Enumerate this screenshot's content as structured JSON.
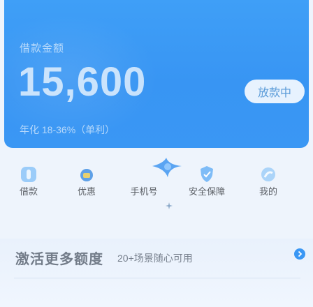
{
  "hero": {
    "label": "借款金额",
    "amount": "15,600",
    "rate": "年化 18-36%（单利）",
    "button_label": "放款中"
  },
  "services": {
    "items": [
      {
        "label": "借款",
        "icon": "borrow-icon"
      },
      {
        "label": "优惠",
        "icon": "coupon-icon"
      },
      {
        "label": "手机号",
        "icon": "phone-icon"
      },
      {
        "label": "安全保障",
        "icon": "shield-icon"
      },
      {
        "label": "我的",
        "icon": "profile-icon"
      }
    ]
  },
  "banner": {
    "title": "激活更多额度",
    "subtitle": "20+场景随心可用",
    "arrow_icon": "chevron-right-icon"
  },
  "colors": {
    "brand_blue": "#3a97f4",
    "background": "#eef4fc",
    "text_dark": "#3b3f45"
  }
}
